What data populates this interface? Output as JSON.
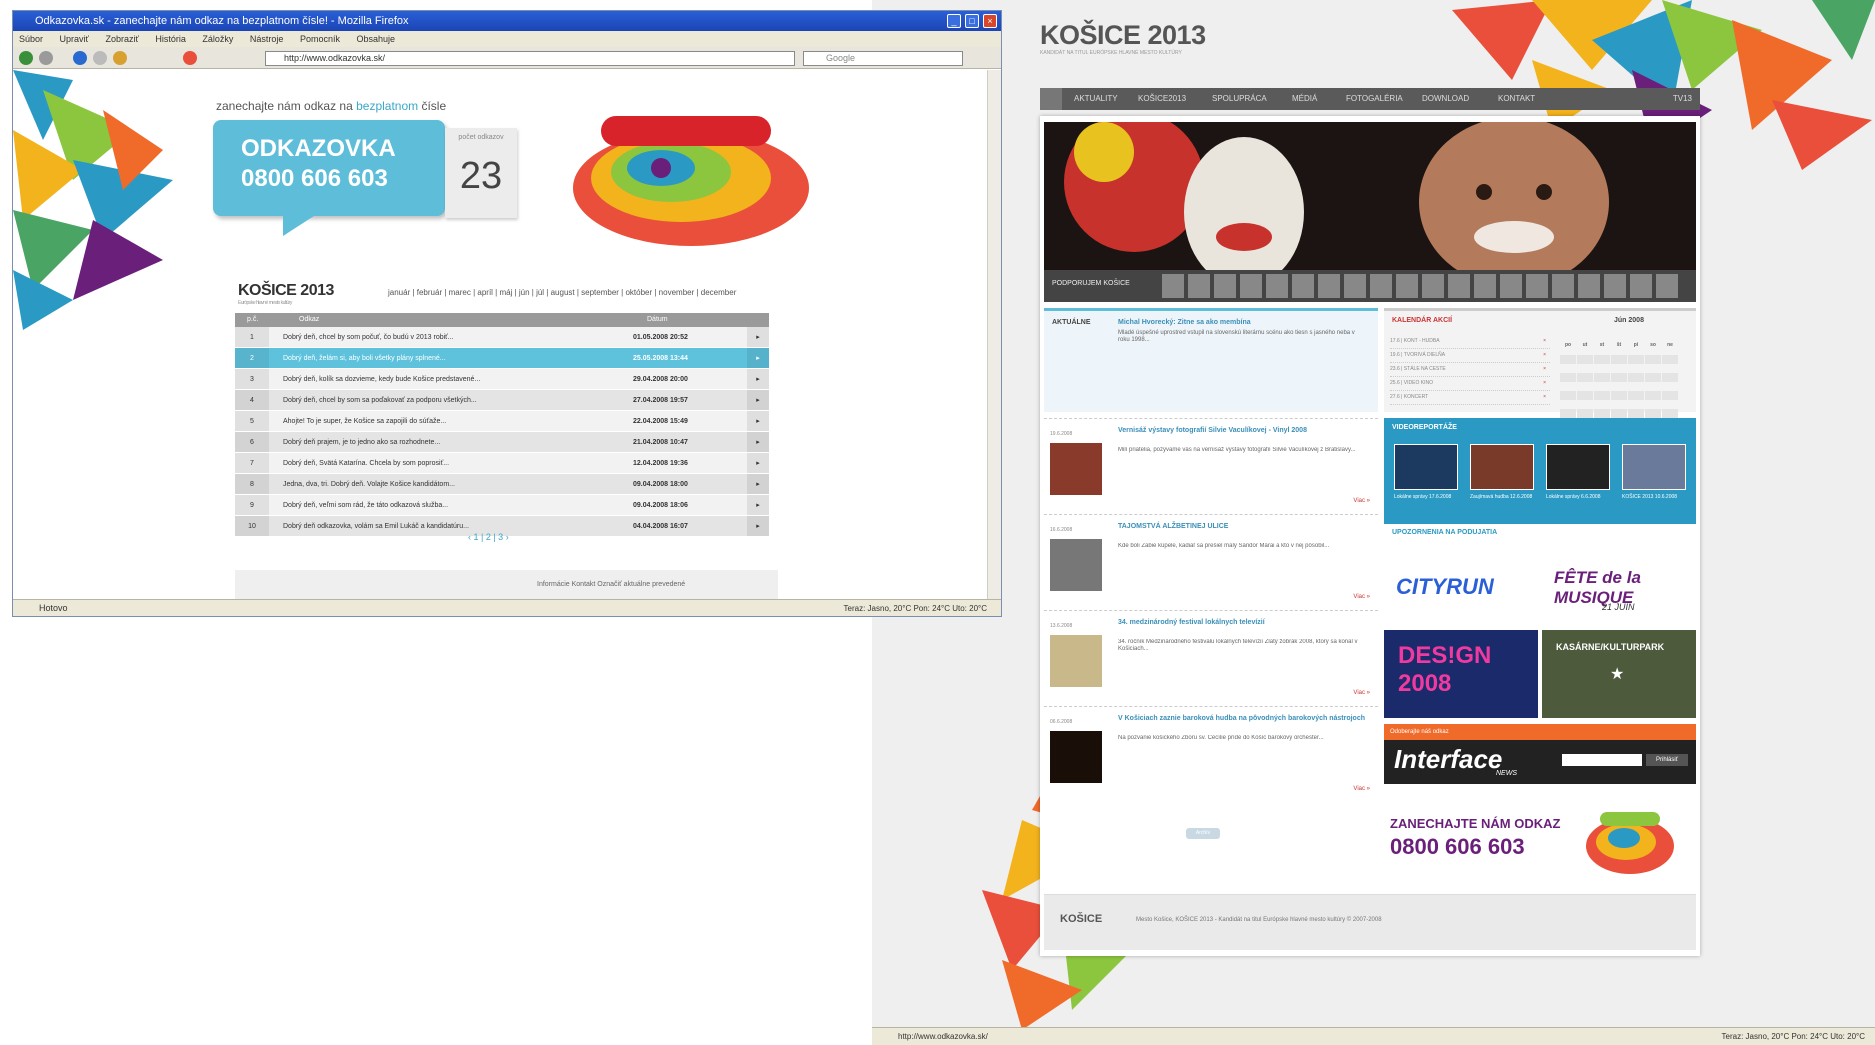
{
  "left_window": {
    "title": "Odkazovka.sk - zanechajte nám odkaz na bezplatnom čísle! - Mozilla Firefox",
    "menu": [
      "Súbor",
      "Upraviť",
      "Zobraziť",
      "História",
      "Záložky",
      "Nástroje",
      "Pomocník",
      "Obsahuje"
    ],
    "url": "http://www.odkazovka.sk/",
    "search_placeholder": "Google",
    "hint_pre": "zanechajte nám odkaz na ",
    "hint_hl": "bezplatnom",
    "hint_post": " čísle",
    "bubble_line1": "ODKAZOVKA",
    "bubble_line2": "0800 606 603",
    "counter_label": "počet odkazov",
    "counter_value": "23",
    "logo": "KOŠICE 2013",
    "logo_sub": "Európske hlavné mesto kultúry",
    "months": "január | február | marec | apríl | máj | jún | júl | august | september | október | november | december",
    "table_headers": [
      "p.č.",
      "Odkaz",
      "Dátum"
    ],
    "rows": [
      {
        "n": "1",
        "t": "Dobrý deň, chcel by som počuť, čo budú v 2013 robiť...",
        "d": "01.05.2008 20:52"
      },
      {
        "n": "2",
        "t": "Dobrý deň, želám si, aby boli všetky plány splnené...",
        "d": "25.05.2008 13:44"
      },
      {
        "n": "3",
        "t": "Dobrý deň, kolík sa dozvieme, kedy bude Košice predstavené...",
        "d": "29.04.2008 20:00"
      },
      {
        "n": "4",
        "t": "Dobrý deň, chcel by som sa poďakovať za podporu všetkých...",
        "d": "27.04.2008 19:57"
      },
      {
        "n": "5",
        "t": "Ahojte! To je super, že Košice sa zapojili do súťaže...",
        "d": "22.04.2008 15:49"
      },
      {
        "n": "6",
        "t": "Dobrý deň prajem, je to jedno ako sa rozhodnete...",
        "d": "21.04.2008 10:47"
      },
      {
        "n": "7",
        "t": "Dobrý deň, Svätá Katarína. Chcela by som poprosiť...",
        "d": "12.04.2008 19:36"
      },
      {
        "n": "8",
        "t": "Jedna, dva, tri. Dobrý deň. Volajte Košice kandidátom...",
        "d": "09.04.2008 18:00"
      },
      {
        "n": "9",
        "t": "Dobrý deň, veľmi som rád, že táto odkazová služba...",
        "d": "09.04.2008 18:06"
      },
      {
        "n": "10",
        "t": "Dobrý deň odkazovka, volám sa Emil Lukáč a kandidatúru...",
        "d": "04.04.2008 16:07"
      }
    ],
    "pager": "‹ 1 | 2 | 3 ›",
    "footer_links": "Informácie    Kontakt    Označiť aktuálne prevedené",
    "status": "Hotovo",
    "status_right": "Teraz: Jasno, 20°C    Pon: 24°C    Uto: 20°C"
  },
  "right_window": {
    "logo": "KOŠICE 2013",
    "logo_sub": "KANDIDÁT NA TITUL EURÓPSKE HLAVNÉ MESTO KULTÚRY",
    "nav": [
      "AKTUALITY",
      "KOŠICE2013",
      "SPOLUPRÁCA",
      "MÉDIÁ",
      "FOTOGALÉRIA",
      "DOWNLOAD",
      "KONTAKT"
    ],
    "nav_right": "TV13",
    "strip_label": "PODPORUJEM KOŠICE",
    "news_label": "AKTUÁLNE",
    "news_title": "Michal Hvorecký: Zitne sa ako membína",
    "news_body": "Mladé úspešné uprostred vstupil na slovenskú literárnu scénu ako tiesn s jasného neba v roku 1998...",
    "calendar_label": "KALENDÁR AKCIÍ",
    "calendar_month": "Jún 2008",
    "calendar_days": [
      "po",
      "ut",
      "st",
      "št",
      "pi",
      "so",
      "ne"
    ],
    "calendar_items": [
      "17.6 | KONT - HUDBA",
      "19.6 | TVORIVÁ DIELŇA",
      "23.6 | STÁLE NA CESTE",
      "25.6 | VIDEO KINO",
      "27.6 | KONCERT"
    ],
    "articles": [
      {
        "date": "19.6.2008",
        "title": "Vernisáž výstavy fotografií Silvie Vaculíkovej - Vinyl 2008",
        "body": "Milí priatelia, pozývame vás na vernisáž výstavy fotografií Silvie Vaculíkovej z Bratislavy...",
        "more": "Viac »"
      },
      {
        "date": "16.6.2008",
        "title": "TAJOMSTVÁ ALŽBETINEJ ULICE",
        "body": "Kde boli Žabie kúpele, kadiaľ sa prešiel malý Sándor Márai a kto v nej pôsobil...",
        "more": "Viac »"
      },
      {
        "date": "13.6.2008",
        "title": "34. medzinárodný festival lokálnych televízií",
        "body": "34. ročník Medzinárodného festivalu lokálnych televízií Zlatý žobrák 2008, ktorý sa konal v Košiciach...",
        "more": "Viac »"
      },
      {
        "date": "06.6.2008",
        "title": "V Košiciach zaznie baroková hudba na pôvodných barokových nástrojoch",
        "body": "Na pozvanie košického Zboru sv. Cecílie príde do Košíc barokový orchester...",
        "more": "Viac »"
      }
    ],
    "more_btn": "Archív",
    "video_label": "VIDEOREPORTÁŽE",
    "videos": [
      "Lokálne správy 17.6.2008",
      "Zaujímavá hudba 12.6.2008",
      "Lokálne správy 6.6.2008",
      "KOŠICE 2013 10.6.2008"
    ],
    "partners_label": "UPOZORNENIA NA PODUJATIA",
    "cityrun": "CITYRUN",
    "musique": "FÊTE de la MUSIQUE",
    "musique_sub": "21 JUIN",
    "design": "DES!GN 2008",
    "kasarne": "KASÁRNE/KULTURPARK",
    "iface_top": "Odoberajte náš odkaz",
    "iface_logo": "Interface",
    "iface_news": "NEWS",
    "iface_btn": "Prihlásiť",
    "promo_a": "ZANECHAJTE NÁM ODKAZ",
    "promo_b": "0800 606 603",
    "footer_logo": "KOŠICE",
    "footer_text": "Mesto Košice, KOŠICE 2013 - Kandidát na titul Európske hlavné mesto kultúry © 2007-2008",
    "status": "http://www.odkazovka.sk/",
    "status_right": "Teraz: Jasno, 20°C    Pon: 24°C    Uto: 20°C"
  },
  "colors": {
    "accent": "#5ebdd8",
    "title_bar": "#1b45b5",
    "purple": "#6a1f7a",
    "orange": "#f06a2a"
  }
}
